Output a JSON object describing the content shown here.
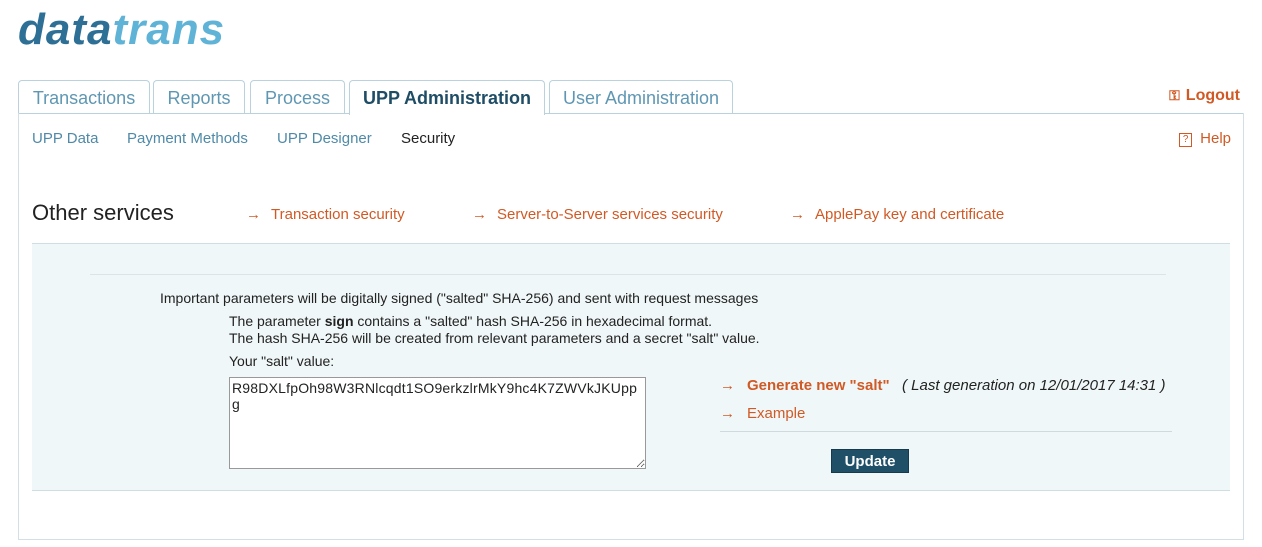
{
  "brand": {
    "part1": "data",
    "part2": "trans"
  },
  "tabs": [
    {
      "label": "Transactions"
    },
    {
      "label": "Reports"
    },
    {
      "label": "Process"
    },
    {
      "label": "UPP Administration"
    },
    {
      "label": "User Administration"
    }
  ],
  "logout": {
    "label": "Logout"
  },
  "subnav": [
    {
      "label": "UPP Data"
    },
    {
      "label": "Payment Methods"
    },
    {
      "label": "UPP Designer"
    },
    {
      "label": "Security"
    }
  ],
  "help": {
    "label": "Help",
    "icon": "?"
  },
  "section": {
    "title": "Other services"
  },
  "service_links": [
    {
      "label": "Transaction security"
    },
    {
      "label": "Server-to-Server services security"
    },
    {
      "label": "ApplePay key and certificate"
    }
  ],
  "content": {
    "intro": "Important parameters will be digitally signed (\"salted\" SHA-256) and sent with request messages",
    "line1_pre": "The parameter ",
    "line1_bold": "sign",
    "line1_post": " contains a \"salted\" hash SHA-256 in hexadecimal format.",
    "line2": "The hash SHA-256 will be created from relevant parameters and a secret \"salt\" value.",
    "salt_label": "Your \"salt\" value:",
    "salt_value": "R98DXLfpOh98W3RNlcqdt1SO9erkzlrMkY9hc4K7ZWVkJKUppg"
  },
  "actions": {
    "generate": "Generate new \"salt\"",
    "last_generation": "( Last generation on 12/01/2017 14:31 )",
    "example": "Example",
    "update": "Update"
  },
  "colors": {
    "accent": "#d05a25",
    "link": "#4f8aa8",
    "button": "#1f5068"
  }
}
